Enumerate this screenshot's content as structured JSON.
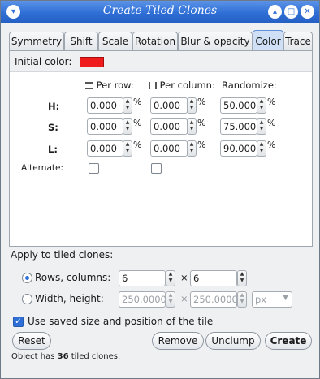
{
  "window": {
    "title": "Create Tiled Clones",
    "menu_glyph": "▾",
    "minimize_glyph": "▴",
    "maximize_glyph": "□",
    "close_glyph": "✕"
  },
  "tabs": [
    {
      "label": "Symmetry",
      "active": false
    },
    {
      "label": "Shift",
      "active": false
    },
    {
      "label": "Scale",
      "active": false
    },
    {
      "label": "Rotation",
      "active": false
    },
    {
      "label": "Blur & opacity",
      "active": false
    },
    {
      "label": "Color",
      "active": true
    },
    {
      "label": "Trace",
      "active": false
    }
  ],
  "color_tab": {
    "initial_color_label": "Initial color:",
    "initial_color": "#ee1c1c",
    "col_per_row": "Per row:",
    "col_per_column": "Per column:",
    "col_randomize": "Randomize:",
    "percent": "%",
    "rows": [
      {
        "label": "H:",
        "per_row": "0.000",
        "per_column": "0.000",
        "randomize": "50.000"
      },
      {
        "label": "S:",
        "per_row": "0.000",
        "per_column": "0.000",
        "randomize": "75.000"
      },
      {
        "label": "L:",
        "per_row": "0.000",
        "per_column": "0.000",
        "randomize": "90.000"
      }
    ],
    "alternate_label": "Alternate:"
  },
  "apply": {
    "heading": "Apply to tiled clones:",
    "rows_columns_label": "Rows, columns:",
    "rows_value": "6",
    "columns_value": "6",
    "times": "×",
    "width_height_label": "Width, height:",
    "width_value": "250.0000",
    "height_value": "250.0000",
    "unit": "px",
    "use_saved_label": "Use saved size and position of the tile"
  },
  "buttons": {
    "reset": "Reset",
    "remove": "Remove",
    "unclump": "Unclump",
    "create": "Create"
  },
  "status": {
    "prefix": "Object has ",
    "count": "36",
    "suffix": " tiled clones."
  },
  "colors": {
    "titlebar": "#2f6fd6",
    "accent": "#2f6fd6",
    "swatch": "#ee1c1c"
  }
}
